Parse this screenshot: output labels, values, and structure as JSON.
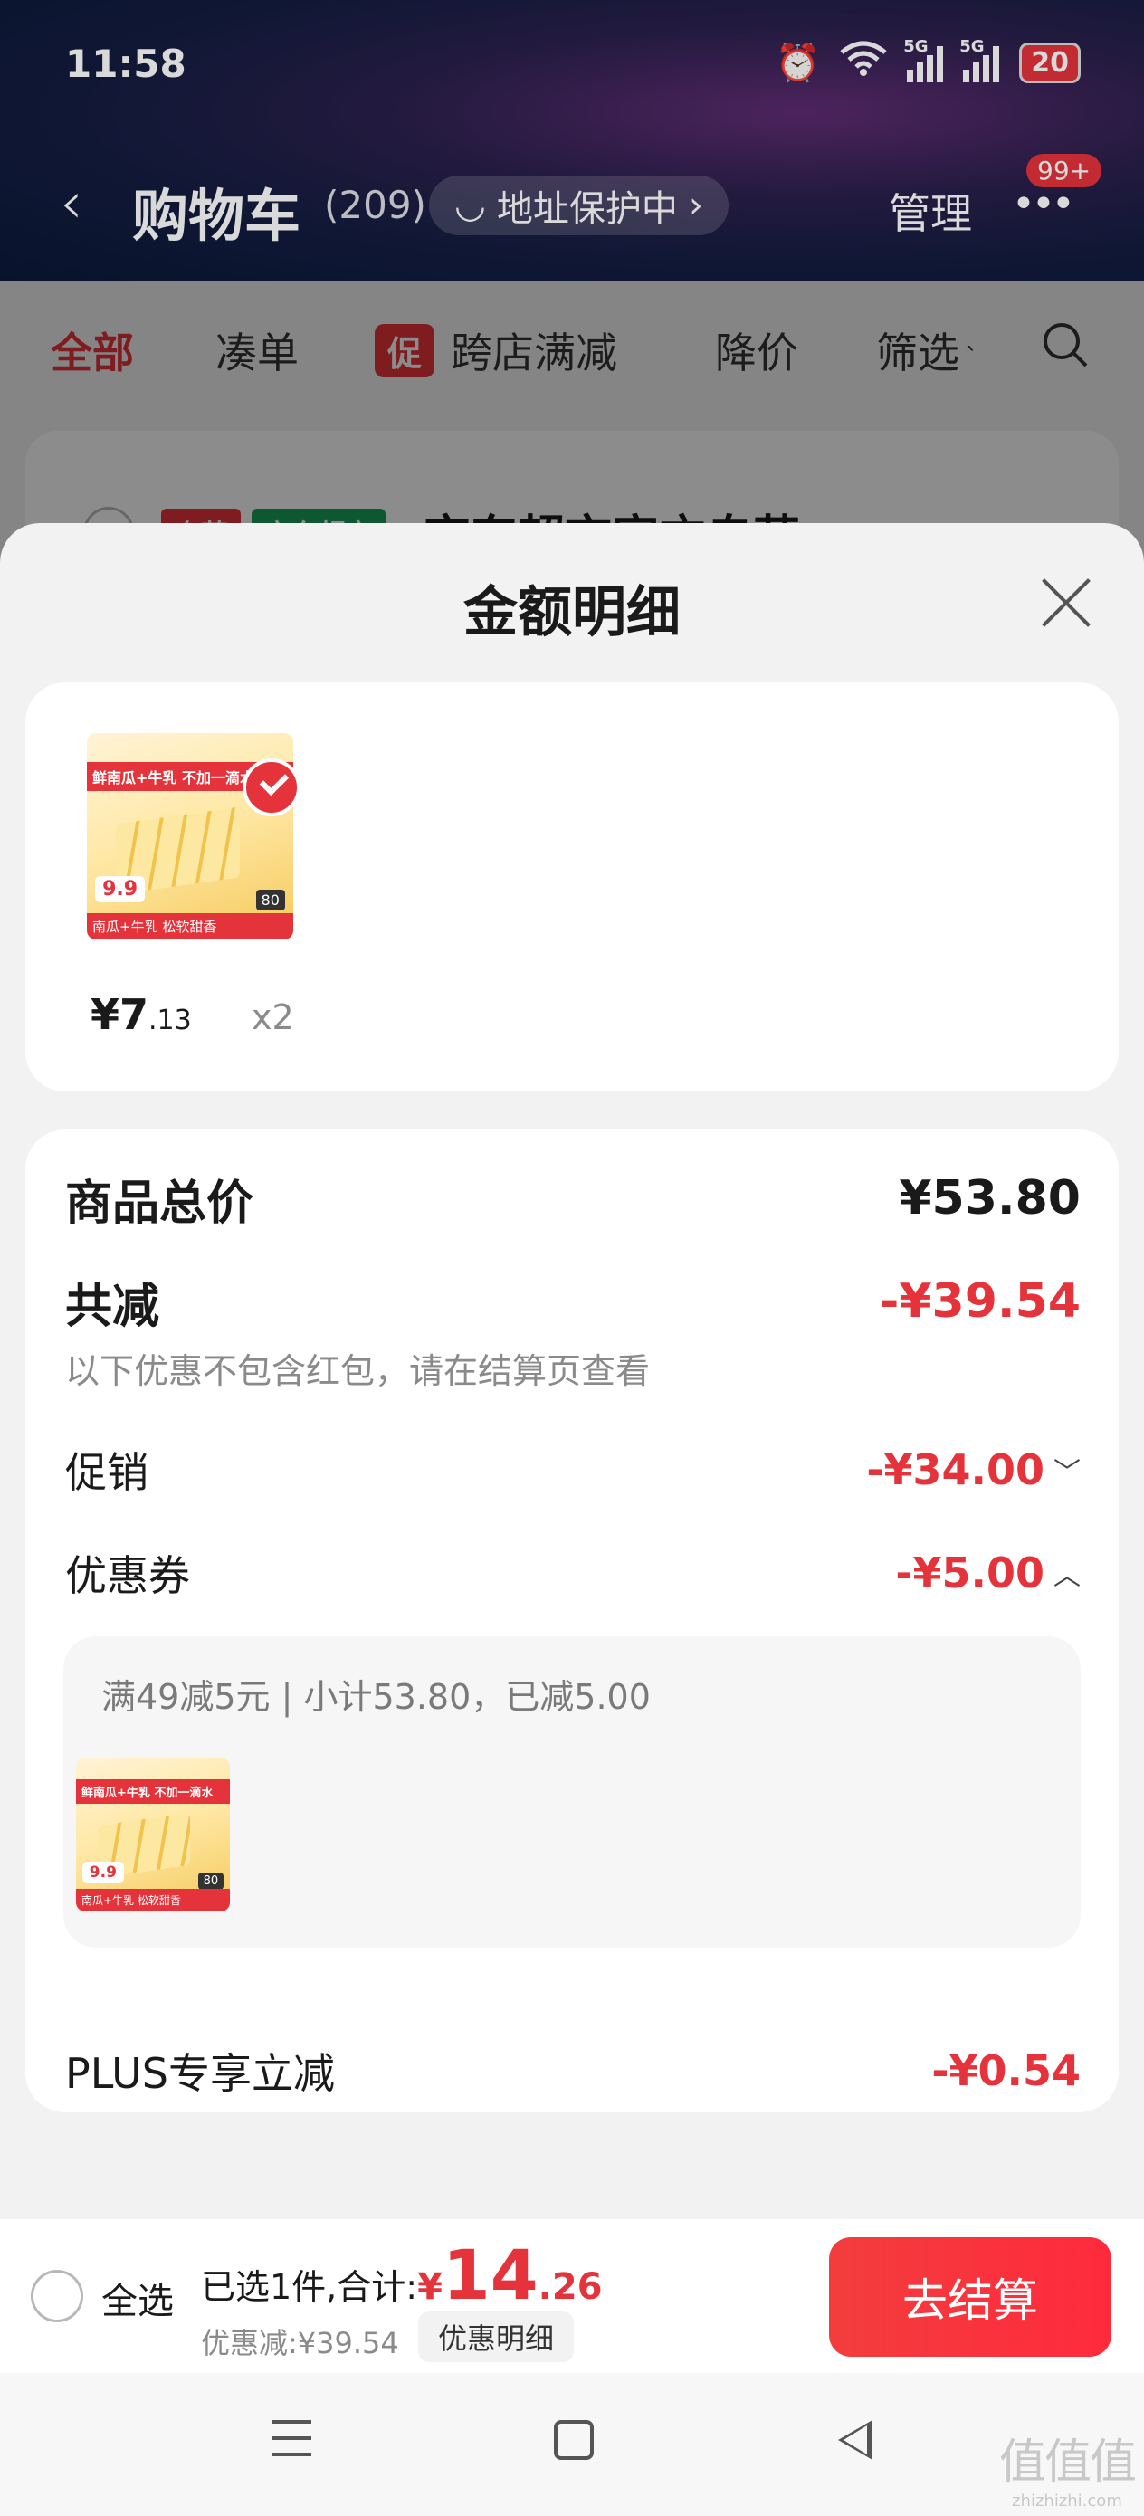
{
  "status_bar": {
    "time": "11:58",
    "network1": "5G",
    "network2": "5G",
    "battery": "20"
  },
  "nav": {
    "back_icon": "chevron-left-icon",
    "title": "购物车",
    "count": "(209)",
    "address_label": "地址保护中",
    "address_arrow": "›",
    "manage": "管理",
    "more_icon": "more-dots-icon",
    "badge": "99+"
  },
  "filters": {
    "all": "全部",
    "order": "凑单",
    "promo_tag": "促",
    "cross_store": "跨店满减",
    "price_drop": "降价",
    "filter": "筛选",
    "filter_caret": "`"
  },
  "bg_store": {
    "tag1": "自营",
    "tag2": "京东超市",
    "name": "京东超市官方自营"
  },
  "sheet": {
    "title": "金额明细",
    "item": {
      "price_int": "¥7",
      "price_dec": ".13",
      "qty": "x2"
    },
    "product_thumb": {
      "headline": "鲜南瓜+牛乳 不加一滴水",
      "price": "9.9",
      "foot": "南瓜+牛乳 松软甜香",
      "tag": "80"
    },
    "totals": {
      "goods_label": "商品总价",
      "goods_value": "¥53.80",
      "reduce_label": "共减",
      "reduce_value": "-¥39.54",
      "reduce_note": "以下优惠不包含红包，请在结算页查看",
      "promo_label": "促销",
      "promo_value": "-¥34.00",
      "promo_chev": "﹀",
      "coupon_label": "优惠券",
      "coupon_value": "-¥5.00",
      "coupon_chev": "︿",
      "coupon_detail": "满49减5元 | 小计53.80，已减5.00",
      "plus_label": "PLUS专享立减",
      "plus_value": "-¥0.54"
    }
  },
  "checkout": {
    "select_all": "全选",
    "summary_prefix": "已选1件,合计:",
    "currency": "¥",
    "total_int": "14",
    "total_dec": ".26",
    "discount": "优惠减:¥39.54",
    "detail_button": "优惠明细",
    "pay_button": "去结算"
  },
  "watermark": {
    "big": "值值值",
    "small": "zhizhizhi.com"
  },
  "colors": {
    "accent": "#e5333b",
    "sheet_bg": "#f2f2f2",
    "card_bg": "#ffffff"
  }
}
